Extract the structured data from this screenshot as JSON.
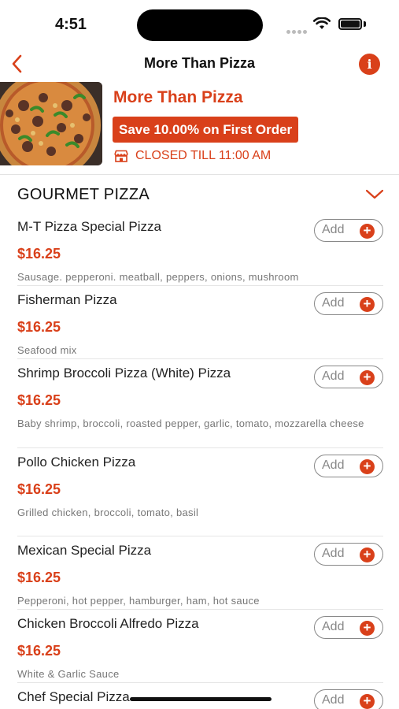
{
  "status_bar": {
    "time": "4:51"
  },
  "nav": {
    "title": "More Than Pizza",
    "info_glyph": "i"
  },
  "restaurant": {
    "name": "More Than Pizza",
    "promo": "Save 10.00% on First Order",
    "status": "CLOSED TILL 11:00 AM"
  },
  "category": {
    "title": "GOURMET PIZZA"
  },
  "add_label": "Add",
  "add_plus": "+",
  "items": [
    {
      "name": "M-T Pizza Special  Pizza",
      "price": "$16.25",
      "description": "Sausage. pepperoni. meatball, peppers, onions, mushroom"
    },
    {
      "name": "Fisherman Pizza",
      "price": "$16.25",
      "description": "Seafood mix"
    },
    {
      "name": "Shrimp Broccoli Pizza (White) Pizza",
      "price": "$16.25",
      "description": "Baby shrimp, broccoli, roasted pepper, garlic, tomato, mozzarella cheese"
    },
    {
      "name": "Pollo Chicken Pizza",
      "price": "$16.25",
      "description": "Grilled chicken, broccoli, tomato, basil"
    },
    {
      "name": "Mexican Special Pizza",
      "price": "$16.25",
      "description": "Pepperoni, hot pepper, hamburger, ham, hot sauce"
    },
    {
      "name": "Chicken Broccoli Alfredo Pizza",
      "price": "$16.25",
      "description": "White & Garlic Sauce"
    },
    {
      "name": "Chef Special Pizza",
      "price": "",
      "description": ""
    }
  ],
  "colors": {
    "accent": "#d9401a",
    "muted": "#777777",
    "divider": "#e6e6e6"
  },
  "icons": {
    "back": "chevron-left-icon",
    "info": "info-icon",
    "store": "store-icon",
    "collapse": "chevron-down-icon",
    "add": "plus-circle-icon"
  }
}
